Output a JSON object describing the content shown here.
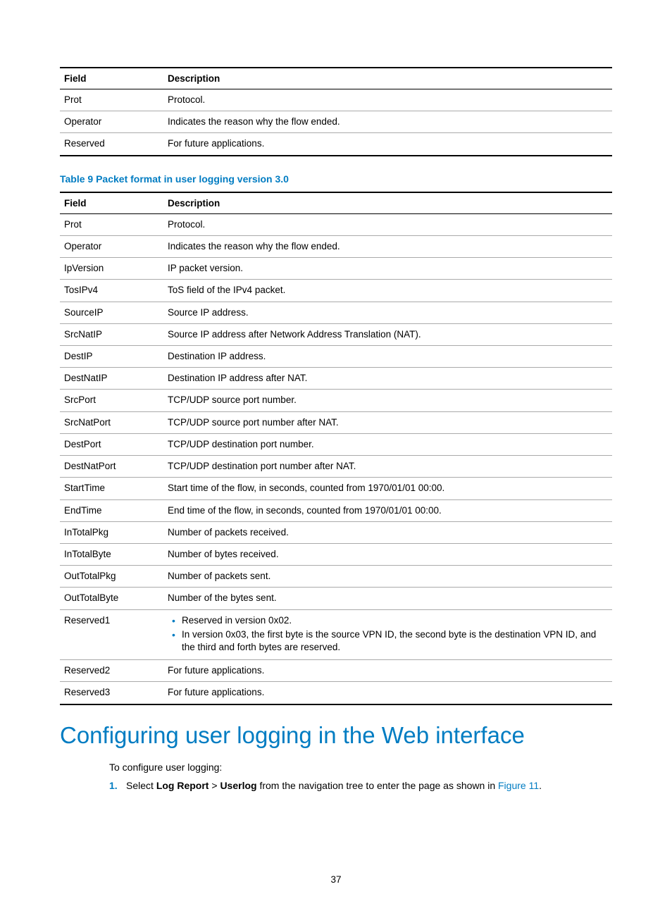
{
  "table_top": {
    "headers": {
      "field": "Field",
      "desc": "Description"
    },
    "rows": [
      {
        "field": "Prot",
        "desc": "Protocol."
      },
      {
        "field": "Operator",
        "desc": "Indicates the reason why the flow ended."
      },
      {
        "field": "Reserved",
        "desc": "For future applications."
      }
    ]
  },
  "table9": {
    "caption": "Table 9 Packet format in user logging version 3.0",
    "headers": {
      "field": "Field",
      "desc": "Description"
    },
    "rows": [
      {
        "field": "Prot",
        "desc": "Protocol."
      },
      {
        "field": "Operator",
        "desc": "Indicates the reason why the flow ended."
      },
      {
        "field": "IpVersion",
        "desc": "IP packet version."
      },
      {
        "field": "TosIPv4",
        "desc": "ToS field of the IPv4 packet."
      },
      {
        "field": "SourceIP",
        "desc": "Source IP address."
      },
      {
        "field": "SrcNatIP",
        "desc": "Source IP address after Network Address Translation (NAT)."
      },
      {
        "field": "DestIP",
        "desc": "Destination IP address."
      },
      {
        "field": "DestNatIP",
        "desc": "Destination IP address after NAT."
      },
      {
        "field": "SrcPort",
        "desc": "TCP/UDP source port number."
      },
      {
        "field": "SrcNatPort",
        "desc": "TCP/UDP source port number after NAT."
      },
      {
        "field": "DestPort",
        "desc": "TCP/UDP destination port number."
      },
      {
        "field": "DestNatPort",
        "desc": "TCP/UDP destination port number after NAT."
      },
      {
        "field": "StartTime",
        "desc": "Start time of the flow, in seconds, counted from 1970/01/01 00:00."
      },
      {
        "field": "EndTime",
        "desc": "End time of the flow, in seconds, counted from 1970/01/01 00:00."
      },
      {
        "field": "InTotalPkg",
        "desc": "Number of packets received."
      },
      {
        "field": "InTotalByte",
        "desc": "Number of bytes received."
      },
      {
        "field": "OutTotalPkg",
        "desc": "Number of packets sent."
      },
      {
        "field": "OutTotalByte",
        "desc": "Number of the bytes sent."
      }
    ],
    "reserved1": {
      "field": "Reserved1",
      "b1": "Reserved in version 0x02.",
      "b2": "In version 0x03, the first byte is the source VPN ID, the second byte is the destination VPN ID, and the third and forth bytes are reserved."
    },
    "rows_after": [
      {
        "field": "Reserved2",
        "desc": "For future applications."
      },
      {
        "field": "Reserved3",
        "desc": "For future applications."
      }
    ]
  },
  "section": {
    "heading": "Configuring user logging in the Web interface",
    "intro": "To configure user logging:",
    "step1_num": "1.",
    "step1_a": "Select ",
    "step1_b": "Log Report",
    "step1_c": " > ",
    "step1_d": "Userlog",
    "step1_e": " from the navigation tree to enter the page as shown in ",
    "step1_link": "Figure 11",
    "step1_f": "."
  },
  "page_number": "37"
}
